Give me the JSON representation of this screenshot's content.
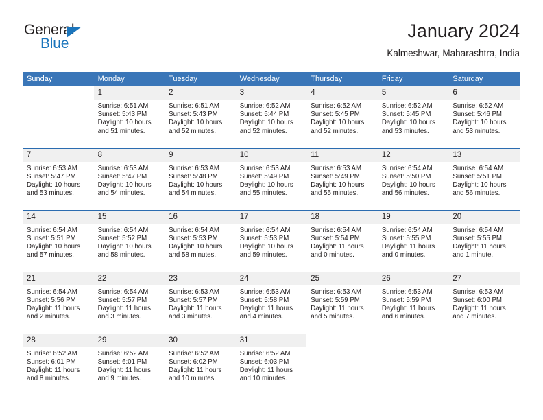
{
  "brand": {
    "name_part1": "General",
    "name_part2": "Blue",
    "logo_icon": "blue-triangle-icon",
    "accent_color": "#1b75bc"
  },
  "header": {
    "title": "January 2024",
    "subtitle": "Kalmeshwar, Maharashtra, India"
  },
  "theme": {
    "header_row_color": "#3a76b8",
    "date_band_color": "#f0f0f0",
    "row_divider_color": "#2b6cb0",
    "text_color": "#231f20"
  },
  "calendar": {
    "weekday_headers": [
      "Sunday",
      "Monday",
      "Tuesday",
      "Wednesday",
      "Thursday",
      "Friday",
      "Saturday"
    ],
    "weeks": [
      [
        {
          "day": "",
          "empty": true
        },
        {
          "day": "1",
          "sunrise": "Sunrise: 6:51 AM",
          "sunset": "Sunset: 5:43 PM",
          "daylight1": "Daylight: 10 hours",
          "daylight2": "and 51 minutes."
        },
        {
          "day": "2",
          "sunrise": "Sunrise: 6:51 AM",
          "sunset": "Sunset: 5:43 PM",
          "daylight1": "Daylight: 10 hours",
          "daylight2": "and 52 minutes."
        },
        {
          "day": "3",
          "sunrise": "Sunrise: 6:52 AM",
          "sunset": "Sunset: 5:44 PM",
          "daylight1": "Daylight: 10 hours",
          "daylight2": "and 52 minutes."
        },
        {
          "day": "4",
          "sunrise": "Sunrise: 6:52 AM",
          "sunset": "Sunset: 5:45 PM",
          "daylight1": "Daylight: 10 hours",
          "daylight2": "and 52 minutes."
        },
        {
          "day": "5",
          "sunrise": "Sunrise: 6:52 AM",
          "sunset": "Sunset: 5:45 PM",
          "daylight1": "Daylight: 10 hours",
          "daylight2": "and 53 minutes."
        },
        {
          "day": "6",
          "sunrise": "Sunrise: 6:52 AM",
          "sunset": "Sunset: 5:46 PM",
          "daylight1": "Daylight: 10 hours",
          "daylight2": "and 53 minutes."
        }
      ],
      [
        {
          "day": "7",
          "sunrise": "Sunrise: 6:53 AM",
          "sunset": "Sunset: 5:47 PM",
          "daylight1": "Daylight: 10 hours",
          "daylight2": "and 53 minutes."
        },
        {
          "day": "8",
          "sunrise": "Sunrise: 6:53 AM",
          "sunset": "Sunset: 5:47 PM",
          "daylight1": "Daylight: 10 hours",
          "daylight2": "and 54 minutes."
        },
        {
          "day": "9",
          "sunrise": "Sunrise: 6:53 AM",
          "sunset": "Sunset: 5:48 PM",
          "daylight1": "Daylight: 10 hours",
          "daylight2": "and 54 minutes."
        },
        {
          "day": "10",
          "sunrise": "Sunrise: 6:53 AM",
          "sunset": "Sunset: 5:49 PM",
          "daylight1": "Daylight: 10 hours",
          "daylight2": "and 55 minutes."
        },
        {
          "day": "11",
          "sunrise": "Sunrise: 6:53 AM",
          "sunset": "Sunset: 5:49 PM",
          "daylight1": "Daylight: 10 hours",
          "daylight2": "and 55 minutes."
        },
        {
          "day": "12",
          "sunrise": "Sunrise: 6:54 AM",
          "sunset": "Sunset: 5:50 PM",
          "daylight1": "Daylight: 10 hours",
          "daylight2": "and 56 minutes."
        },
        {
          "day": "13",
          "sunrise": "Sunrise: 6:54 AM",
          "sunset": "Sunset: 5:51 PM",
          "daylight1": "Daylight: 10 hours",
          "daylight2": "and 56 minutes."
        }
      ],
      [
        {
          "day": "14",
          "sunrise": "Sunrise: 6:54 AM",
          "sunset": "Sunset: 5:51 PM",
          "daylight1": "Daylight: 10 hours",
          "daylight2": "and 57 minutes."
        },
        {
          "day": "15",
          "sunrise": "Sunrise: 6:54 AM",
          "sunset": "Sunset: 5:52 PM",
          "daylight1": "Daylight: 10 hours",
          "daylight2": "and 58 minutes."
        },
        {
          "day": "16",
          "sunrise": "Sunrise: 6:54 AM",
          "sunset": "Sunset: 5:53 PM",
          "daylight1": "Daylight: 10 hours",
          "daylight2": "and 58 minutes."
        },
        {
          "day": "17",
          "sunrise": "Sunrise: 6:54 AM",
          "sunset": "Sunset: 5:53 PM",
          "daylight1": "Daylight: 10 hours",
          "daylight2": "and 59 minutes."
        },
        {
          "day": "18",
          "sunrise": "Sunrise: 6:54 AM",
          "sunset": "Sunset: 5:54 PM",
          "daylight1": "Daylight: 11 hours",
          "daylight2": "and 0 minutes."
        },
        {
          "day": "19",
          "sunrise": "Sunrise: 6:54 AM",
          "sunset": "Sunset: 5:55 PM",
          "daylight1": "Daylight: 11 hours",
          "daylight2": "and 0 minutes."
        },
        {
          "day": "20",
          "sunrise": "Sunrise: 6:54 AM",
          "sunset": "Sunset: 5:55 PM",
          "daylight1": "Daylight: 11 hours",
          "daylight2": "and 1 minute."
        }
      ],
      [
        {
          "day": "21",
          "sunrise": "Sunrise: 6:54 AM",
          "sunset": "Sunset: 5:56 PM",
          "daylight1": "Daylight: 11 hours",
          "daylight2": "and 2 minutes."
        },
        {
          "day": "22",
          "sunrise": "Sunrise: 6:54 AM",
          "sunset": "Sunset: 5:57 PM",
          "daylight1": "Daylight: 11 hours",
          "daylight2": "and 3 minutes."
        },
        {
          "day": "23",
          "sunrise": "Sunrise: 6:53 AM",
          "sunset": "Sunset: 5:57 PM",
          "daylight1": "Daylight: 11 hours",
          "daylight2": "and 3 minutes."
        },
        {
          "day": "24",
          "sunrise": "Sunrise: 6:53 AM",
          "sunset": "Sunset: 5:58 PM",
          "daylight1": "Daylight: 11 hours",
          "daylight2": "and 4 minutes."
        },
        {
          "day": "25",
          "sunrise": "Sunrise: 6:53 AM",
          "sunset": "Sunset: 5:59 PM",
          "daylight1": "Daylight: 11 hours",
          "daylight2": "and 5 minutes."
        },
        {
          "day": "26",
          "sunrise": "Sunrise: 6:53 AM",
          "sunset": "Sunset: 5:59 PM",
          "daylight1": "Daylight: 11 hours",
          "daylight2": "and 6 minutes."
        },
        {
          "day": "27",
          "sunrise": "Sunrise: 6:53 AM",
          "sunset": "Sunset: 6:00 PM",
          "daylight1": "Daylight: 11 hours",
          "daylight2": "and 7 minutes."
        }
      ],
      [
        {
          "day": "28",
          "sunrise": "Sunrise: 6:52 AM",
          "sunset": "Sunset: 6:01 PM",
          "daylight1": "Daylight: 11 hours",
          "daylight2": "and 8 minutes."
        },
        {
          "day": "29",
          "sunrise": "Sunrise: 6:52 AM",
          "sunset": "Sunset: 6:01 PM",
          "daylight1": "Daylight: 11 hours",
          "daylight2": "and 9 minutes."
        },
        {
          "day": "30",
          "sunrise": "Sunrise: 6:52 AM",
          "sunset": "Sunset: 6:02 PM",
          "daylight1": "Daylight: 11 hours",
          "daylight2": "and 10 minutes."
        },
        {
          "day": "31",
          "sunrise": "Sunrise: 6:52 AM",
          "sunset": "Sunset: 6:03 PM",
          "daylight1": "Daylight: 11 hours",
          "daylight2": "and 10 minutes."
        },
        {
          "day": "",
          "empty": true
        },
        {
          "day": "",
          "empty": true
        },
        {
          "day": "",
          "empty": true
        }
      ]
    ]
  }
}
